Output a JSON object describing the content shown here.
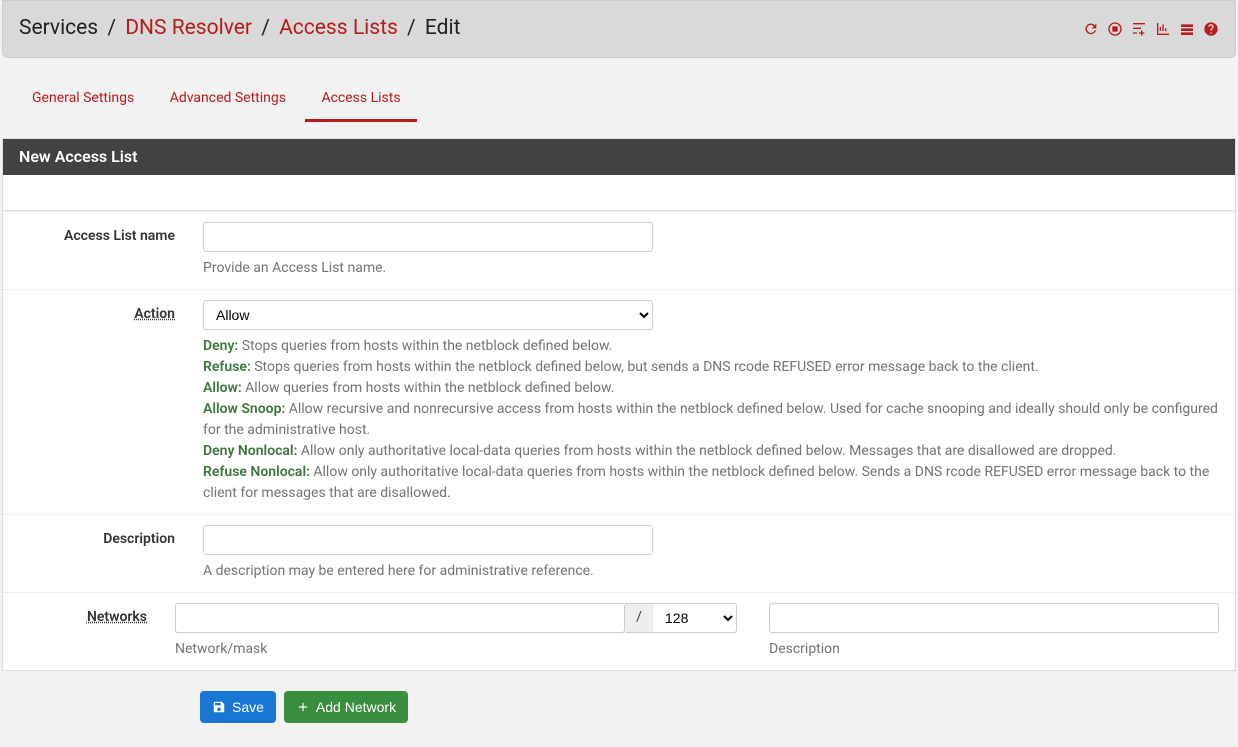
{
  "breadcrumb": {
    "service": "Services",
    "resolver": "DNS Resolver",
    "acl": "Access Lists",
    "edit": "Edit"
  },
  "tabs": [
    "General Settings",
    "Advanced Settings",
    "Access Lists"
  ],
  "panel_title": "New Access List",
  "labels": {
    "name": "Access List name",
    "action": "Action",
    "description": "Description",
    "networks": "Networks"
  },
  "fields": {
    "name_value": "",
    "action_value": "Allow",
    "description_value": "",
    "network_value": "",
    "mask_value": "128",
    "net_desc_value": ""
  },
  "help": {
    "name": "Provide an Access List name.",
    "description": "A description may be entered here for administrative reference.",
    "network_mask": "Network/mask",
    "net_description": "Description"
  },
  "action_help": {
    "deny_label": "Deny:",
    "deny_text": " Stops queries from hosts within the netblock defined below.",
    "refuse_label": "Refuse:",
    "refuse_text": " Stops queries from hosts within the netblock defined below, but sends a DNS rcode REFUSED error message back to the client.",
    "allow_label": "Allow:",
    "allow_text": " Allow queries from hosts within the netblock defined below.",
    "snoop_label": "Allow Snoop:",
    "snoop_text": " Allow recursive and nonrecursive access from hosts within the netblock defined below. Used for cache snooping and ideally should only be configured for the administrative host.",
    "deny_nl_label": "Deny Nonlocal:",
    "deny_nl_text": " Allow only authoritative local-data queries from hosts within the netblock defined below. Messages that are disallowed are dropped.",
    "refuse_nl_label": "Refuse Nonlocal:",
    "refuse_nl_text": " Allow only authoritative local-data queries from hosts within the netblock defined below. Sends a DNS rcode REFUSED error message back to the client for messages that are disallowed."
  },
  "buttons": {
    "save": "Save",
    "add_network": "Add Network"
  },
  "slash": "/"
}
